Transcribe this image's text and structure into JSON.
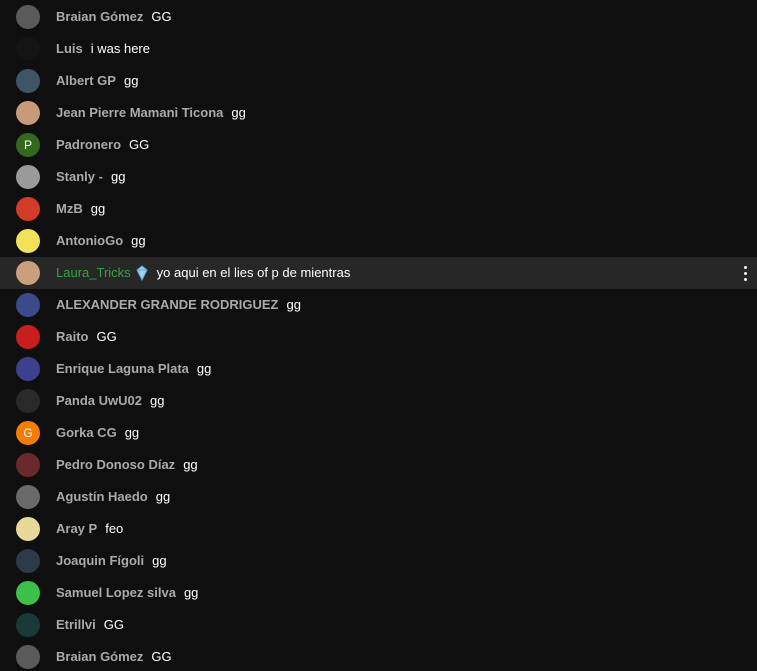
{
  "chat": {
    "messages": [
      {
        "author": "Braian Gómez",
        "text": "GG",
        "avatar": {
          "color": "#5a5a5a",
          "icon": "photo-avatar"
        }
      },
      {
        "author": "Luis",
        "text": "i was here",
        "avatar": {
          "color": "#141414",
          "icon": "photo-avatar"
        }
      },
      {
        "author": "Albert GP",
        "text": "gg",
        "avatar": {
          "color": "#3e5566",
          "icon": "photo-avatar"
        }
      },
      {
        "author": "Jean Pierre Mamani Ticona",
        "text": "gg",
        "avatar": {
          "color": "#c79a7a",
          "icon": "photo-avatar"
        }
      },
      {
        "author": "Padronero",
        "text": "GG",
        "avatar": {
          "color": "#33691e",
          "letter": "P"
        }
      },
      {
        "author": "Stanly -",
        "text": "gg",
        "avatar": {
          "color": "#9a9a9a",
          "icon": "photo-avatar"
        }
      },
      {
        "author": "MzB",
        "text": "gg",
        "avatar": {
          "color": "#d43c2a",
          "icon": "photo-avatar"
        }
      },
      {
        "author": "AntonioGo",
        "text": "gg",
        "avatar": {
          "color": "#f2e25a",
          "icon": "photo-avatar"
        }
      },
      {
        "author": "Laura_Tricks",
        "text": "yo aqui en el lies of p de mientras",
        "avatar": {
          "color": "#caa07c",
          "icon": "photo-avatar"
        },
        "member": true,
        "badge": "member-badge-icon"
      },
      {
        "author": "ALEXANDER GRANDE RODRIGUEZ",
        "text": "gg",
        "avatar": {
          "color": "#3a4a8a",
          "icon": "photo-avatar"
        }
      },
      {
        "author": "Raito",
        "text": "GG",
        "avatar": {
          "color": "#c81e1e",
          "icon": "photo-avatar"
        }
      },
      {
        "author": "Enrique Laguna Plata",
        "text": "gg",
        "avatar": {
          "color": "#3d3f8f",
          "icon": "photo-avatar"
        }
      },
      {
        "author": "Panda UwU02",
        "text": "gg",
        "avatar": {
          "color": "#2a2a2a",
          "icon": "photo-avatar"
        }
      },
      {
        "author": "Gorka CG",
        "text": "gg",
        "avatar": {
          "color": "#f57c00",
          "letter": "G"
        }
      },
      {
        "author": "Pedro Donoso Díaz",
        "text": "gg",
        "avatar": {
          "color": "#6a2a2a",
          "icon": "photo-avatar"
        }
      },
      {
        "author": "Agustín Haedo",
        "text": "gg",
        "avatar": {
          "color": "#6a6a6a",
          "icon": "photo-avatar"
        }
      },
      {
        "author": "Aray P",
        "text": "feo",
        "avatar": {
          "color": "#e8d89a",
          "icon": "photo-avatar"
        }
      },
      {
        "author": "Joaquin Fígoli",
        "text": "gg",
        "avatar": {
          "color": "#2c3a48",
          "icon": "photo-avatar"
        }
      },
      {
        "author": "Samuel Lopez silva",
        "text": "gg",
        "avatar": {
          "color": "#3cc04a",
          "icon": "photo-avatar"
        }
      },
      {
        "author": "Etrillvi",
        "text": "GG",
        "avatar": {
          "color": "#1a3a3a",
          "icon": "photo-avatar"
        }
      },
      {
        "author": "Braian Gómez",
        "text": "GG",
        "avatar": {
          "color": "#5a5a5a",
          "icon": "photo-avatar"
        }
      }
    ],
    "highlighted_index": 8,
    "menu_icon": "more-vert-icon"
  }
}
